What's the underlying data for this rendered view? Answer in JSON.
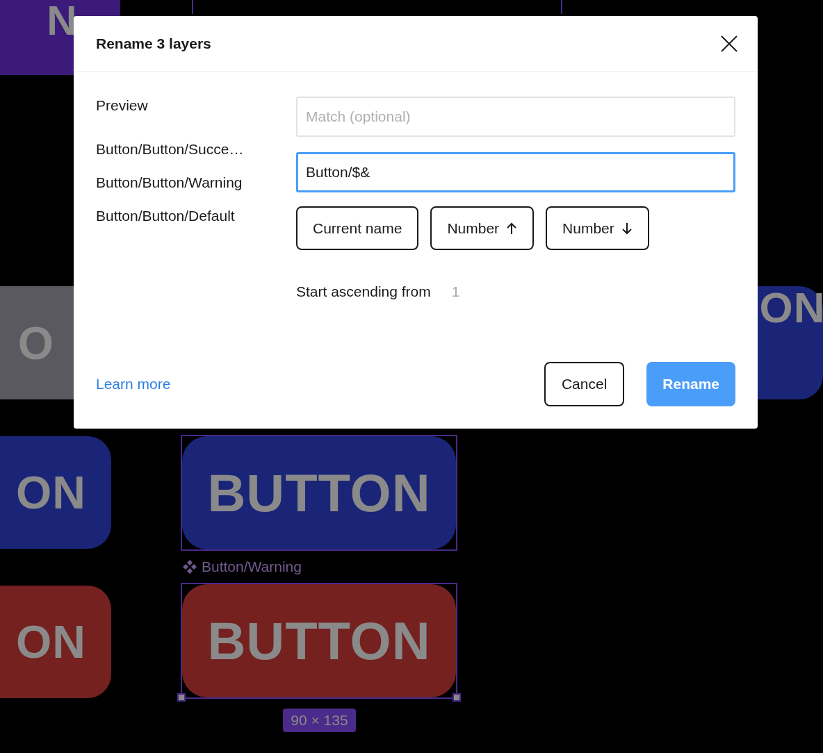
{
  "canvas": {
    "tiles": [
      {
        "label": "N",
        "color": "#3b1a7a"
      },
      {
        "label": "O",
        "color": "#5a5960"
      },
      {
        "label": "ON",
        "color": "#1b2577"
      },
      {
        "label": "ON",
        "color": "#1b2577"
      },
      {
        "label": "ON",
        "color": "#74211f"
      }
    ],
    "selection": {
      "layers": [
        {
          "label": "BUTTON",
          "color": "#1b2577"
        },
        {
          "name": "Button/Warning",
          "label": "BUTTON",
          "color": "#74211f"
        }
      ],
      "size": "90 × 135"
    }
  },
  "dialog": {
    "title": "Rename 3 layers",
    "preview": {
      "label": "Preview",
      "items": [
        "Button/Button/Succe…",
        "Button/Button/Warning",
        "Button/Button/Default"
      ]
    },
    "match_field": {
      "placeholder": "Match (optional)"
    },
    "rename_field": {
      "value": "Button/$&",
      "focused": true
    },
    "tokens": [
      {
        "label": "Current name",
        "kind": "plain"
      },
      {
        "label": "Number",
        "kind": "ascending"
      },
      {
        "label": "Number",
        "kind": "descending"
      }
    ],
    "start": {
      "label": "Start ascending from",
      "value": "1"
    },
    "learn_more": "Learn more",
    "buttons": [
      {
        "label": "Cancel",
        "kind": "secondary"
      },
      {
        "label": "Rename",
        "kind": "primary"
      }
    ]
  }
}
